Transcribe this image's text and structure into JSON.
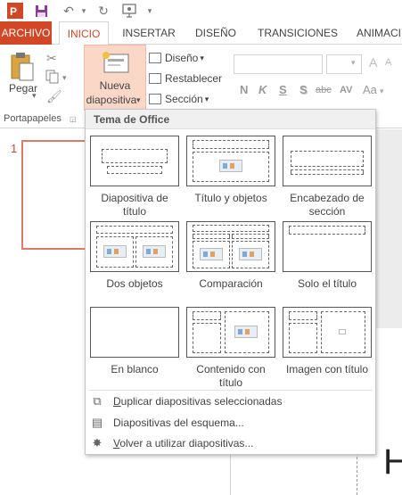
{
  "qat": {
    "app_icon": "powerpoint-icon",
    "save_icon": "save-icon",
    "undo_icon": "undo-icon",
    "redo_icon": "redo-icon",
    "present_icon": "present-from-beginning-icon",
    "customize_icon": "customize-toolbar-icon"
  },
  "tabs": [
    {
      "label": "ARCHIVO"
    },
    {
      "label": "INICIO"
    },
    {
      "label": "INSERTAR"
    },
    {
      "label": "DISEÑO"
    },
    {
      "label": "TRANSICIONES"
    },
    {
      "label": "ANIMACI"
    }
  ],
  "ribbon": {
    "paste_label": "Pegar",
    "clipboard_group": "Portapapeles",
    "new_slide_line1": "Nueva",
    "new_slide_line2": "diapositiva",
    "layout_label": "Diseño",
    "reset_label": "Restablecer",
    "section_label": "Sección",
    "format_buttons": [
      "N",
      "K",
      "S",
      "S",
      "abc",
      "AV",
      "Aa"
    ]
  },
  "slides": {
    "first_number": "1"
  },
  "dropdown": {
    "header": "Tema de Office",
    "layouts": [
      {
        "line1": "Diapositiva de",
        "line2": "título"
      },
      {
        "line1": "Título y objetos",
        "line2": ""
      },
      {
        "line1": "Encabezado de",
        "line2": "sección"
      },
      {
        "line1": "Dos objetos",
        "line2": ""
      },
      {
        "line1": "Comparación",
        "line2": ""
      },
      {
        "line1": "Solo el título",
        "line2": ""
      },
      {
        "line1": "En blanco",
        "line2": ""
      },
      {
        "line1": "Contenido con",
        "line2": "título"
      },
      {
        "line1": "Imagen con título",
        "line2": ""
      }
    ],
    "menu": [
      {
        "accel": "D",
        "rest": "uplicar diapositivas seleccionadas"
      },
      {
        "accel": "",
        "rest": "Diapositivas del esquema..."
      },
      {
        "accel": "V",
        "rest": "olver a utilizar diapositivas..."
      }
    ]
  },
  "colors": {
    "accent": "#d24726",
    "thumb_border": "#e07b63",
    "new_slide_highlight": "#fbd7c8"
  }
}
